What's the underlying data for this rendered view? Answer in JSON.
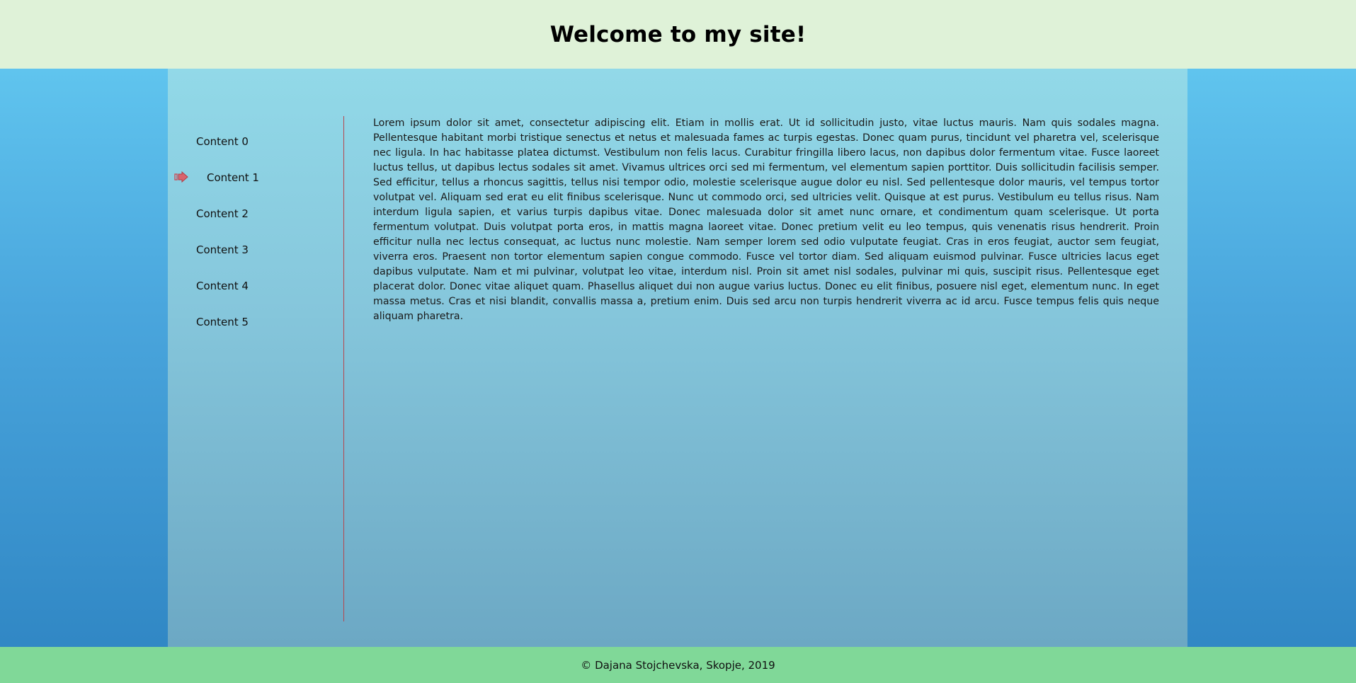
{
  "header": {
    "title": "Welcome to my site!"
  },
  "sidebar": {
    "items": [
      {
        "label": "Content 0"
      },
      {
        "label": "Content 1",
        "active": true
      },
      {
        "label": "Content 2"
      },
      {
        "label": "Content 3"
      },
      {
        "label": "Content 4"
      },
      {
        "label": "Content 5"
      }
    ],
    "active_icon": "arrow-right-icon"
  },
  "main": {
    "text": "Lorem ipsum dolor sit amet, consectetur adipiscing elit. Etiam in mollis erat. Ut id sollicitudin justo, vitae luctus mauris. Nam quis sodales magna. Pellentesque habitant morbi tristique senectus et netus et malesuada fames ac turpis egestas. Donec quam purus, tincidunt vel pharetra vel, scelerisque nec ligula. In hac habitasse platea dictumst. Vestibulum non felis lacus. Curabitur fringilla libero lacus, non dapibus dolor fermentum vitae. Fusce laoreet luctus tellus, ut dapibus lectus sodales sit amet. Vivamus ultrices orci sed mi fermentum, vel elementum sapien porttitor. Duis sollicitudin facilisis semper. Sed efficitur, tellus a rhoncus sagittis, tellus nisi tempor odio, molestie scelerisque augue dolor eu nisl. Sed pellentesque dolor mauris, vel tempus tortor volutpat vel. Aliquam sed erat eu elit finibus scelerisque. Nunc ut commodo orci, sed ultricies velit. Quisque at est purus. Vestibulum eu tellus risus. Nam interdum ligula sapien, et varius turpis dapibus vitae. Donec malesuada dolor sit amet nunc ornare, et condimentum quam scelerisque. Ut porta fermentum volutpat. Duis volutpat porta eros, in mattis magna laoreet vitae. Donec pretium velit eu leo tempus, quis venenatis risus hendrerit. Proin efficitur nulla nec lectus consequat, ac luctus nunc molestie. Nam semper lorem sed odio vulputate feugiat. Cras in eros feugiat, auctor sem feugiat, viverra eros. Praesent non tortor elementum sapien congue commodo. Fusce vel tortor diam. Sed aliquam euismod pulvinar. Fusce ultricies lacus eget dapibus vulputate. Nam et mi pulvinar, volutpat leo vitae, interdum nisl. Proin sit amet nisl sodales, pulvinar mi quis, suscipit risus. Pellentesque eget placerat dolor. Donec vitae aliquet quam. Phasellus aliquet dui non augue varius luctus. Donec eu elit finibus, posuere nisl eget, elementum nunc. In eget massa metus. Cras et nisi blandit, convallis massa a, pretium enim. Duis sed arcu non turpis hendrerit viverra ac id arcu. Fusce tempus felis quis neque aliquam pharetra."
  },
  "footer": {
    "text": "© Dajana Stojchevska, Skopje, 2019"
  },
  "colors": {
    "header_bg": "#dff2d8",
    "footer_bg": "#80d898",
    "divider": "#b5474e",
    "arrow": "#c9505a"
  }
}
